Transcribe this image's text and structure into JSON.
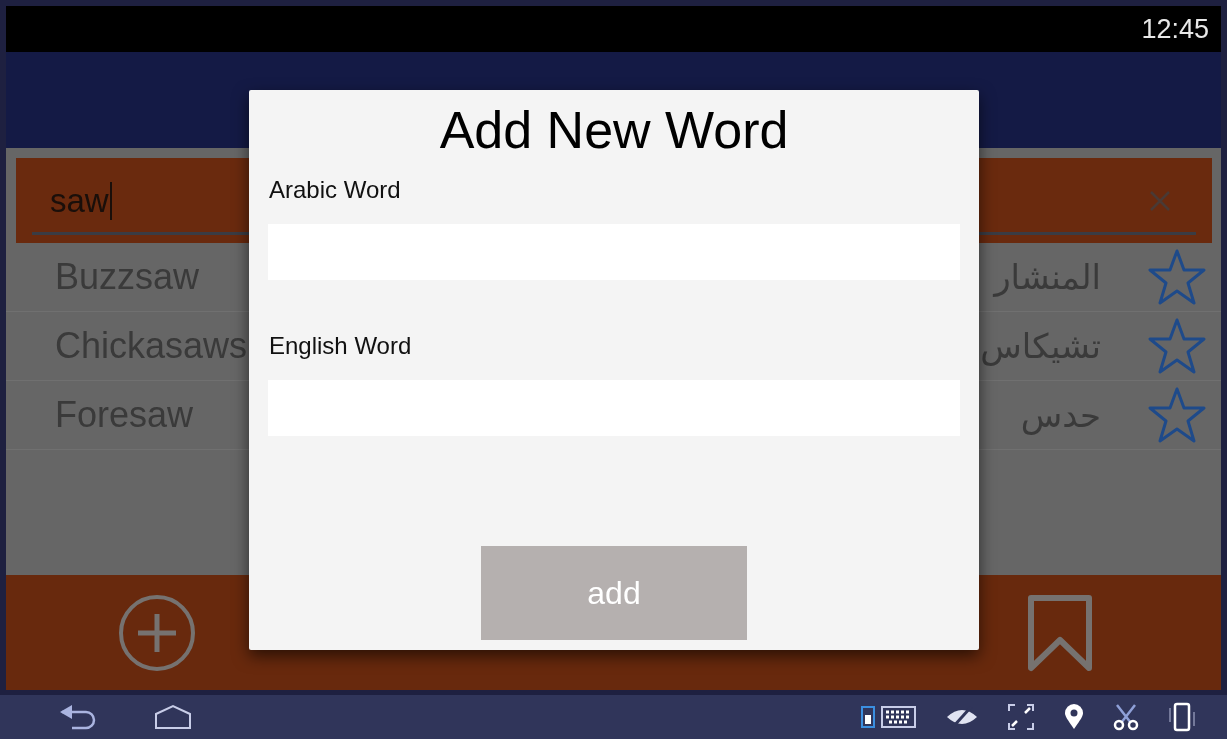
{
  "status_bar": {
    "time": "12:45"
  },
  "search": {
    "value": "saw"
  },
  "results": [
    {
      "english": "Buzzsaw",
      "arabic": "المنشار",
      "favorite": false
    },
    {
      "english": "Chickasaws",
      "arabic": "تشيكاس",
      "favorite": false
    },
    {
      "english": "Foresaw",
      "arabic": "حدس",
      "favorite": false
    }
  ],
  "dialog": {
    "title": "Add New Word",
    "fields": [
      {
        "label": "Arabic Word"
      },
      {
        "label": "English Word"
      }
    ],
    "button": "add"
  }
}
